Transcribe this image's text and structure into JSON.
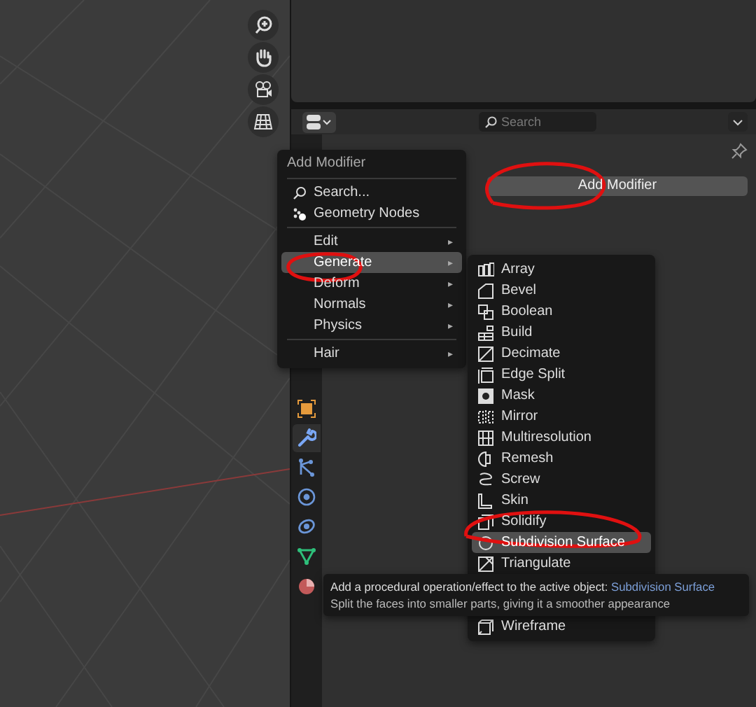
{
  "properties": {
    "search": {
      "placeholder": "Search"
    },
    "add_button": "Add Modifier",
    "tabs": [
      {
        "kind": "object",
        "selected": false
      },
      {
        "kind": "modifier",
        "selected": true
      },
      {
        "kind": "particles",
        "selected": false
      },
      {
        "kind": "physics",
        "selected": false
      },
      {
        "kind": "constraints",
        "selected": false
      },
      {
        "kind": "data",
        "selected": false
      },
      {
        "kind": "material",
        "selected": false
      }
    ]
  },
  "menu": {
    "title": "Add Modifier",
    "items": [
      {
        "kind": "search",
        "label": "Search...",
        "selected": false
      },
      {
        "kind": "nodes",
        "label": "Geometry Nodes",
        "selected": false
      },
      {
        "kind": "separator"
      },
      {
        "kind": "submenu",
        "label": "Edit",
        "arrow": "▸",
        "selected": false
      },
      {
        "kind": "submenu",
        "label": "Generate",
        "arrow": "▸",
        "selected": true
      },
      {
        "kind": "submenu",
        "label": "Deform",
        "arrow": "▸",
        "selected": false
      },
      {
        "kind": "submenu",
        "label": "Normals",
        "arrow": "▸",
        "selected": false
      },
      {
        "kind": "submenu",
        "label": "Physics",
        "arrow": "▸",
        "selected": false
      },
      {
        "kind": "separator"
      },
      {
        "kind": "submenu",
        "label": "Hair",
        "arrow": "▸",
        "selected": false
      }
    ]
  },
  "submenu": {
    "items": [
      {
        "label": "Array",
        "selected": false
      },
      {
        "label": "Bevel",
        "selected": false
      },
      {
        "label": "Boolean",
        "selected": false
      },
      {
        "label": "Build",
        "selected": false
      },
      {
        "label": "Decimate",
        "selected": false
      },
      {
        "label": "Edge Split",
        "selected": false
      },
      {
        "label": "Mask",
        "selected": false
      },
      {
        "label": "Mirror",
        "selected": false
      },
      {
        "label": "Multiresolution",
        "selected": false
      },
      {
        "label": "Remesh",
        "selected": false
      },
      {
        "label": "Screw",
        "selected": false
      },
      {
        "label": "Skin",
        "selected": false
      },
      {
        "label": "Solidify",
        "selected": false
      },
      {
        "label": "Subdivision Surface",
        "selected": true
      },
      {
        "label": "Triangulate",
        "selected": false
      },
      {
        "label": "Wireframe",
        "selected": false
      }
    ]
  },
  "tooltip": {
    "description": "Add a procedural operation/effect to the active object:",
    "target": "Subdivision Surface",
    "detail": "Split the faces into smaller parts, giving it a smoother appearance"
  }
}
